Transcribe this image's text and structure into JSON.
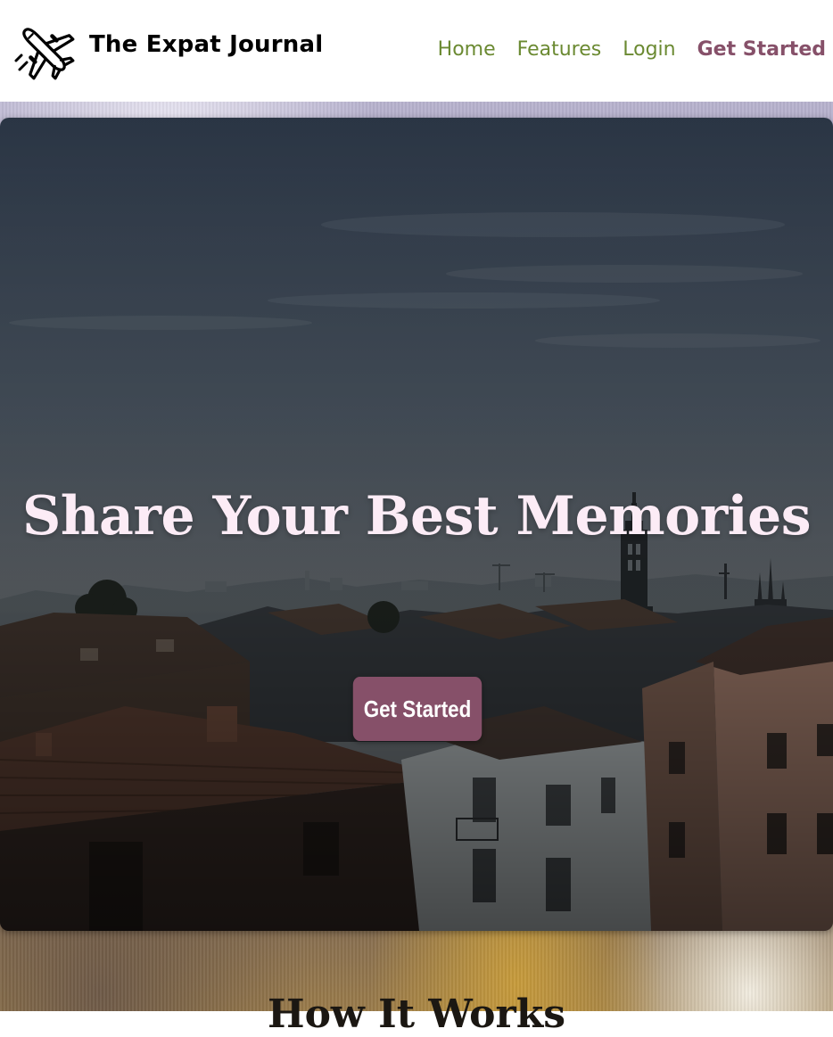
{
  "header": {
    "brand_name": "The Expat Journal",
    "logo_icon": "airplane-icon",
    "nav": [
      {
        "label": "Home"
      },
      {
        "label": "Features"
      },
      {
        "label": "Login"
      },
      {
        "label": "Get Started"
      }
    ]
  },
  "hero": {
    "title": "Share Your Best Memories",
    "button_label": "Get Started",
    "background": "city-rooftops-photo"
  },
  "next_section": {
    "heading": "How It Works"
  },
  "colors": {
    "nav_link": "#6b8a32",
    "accent": "#865069",
    "hero_title": "#fcecf6",
    "text_dark": "#000000"
  }
}
